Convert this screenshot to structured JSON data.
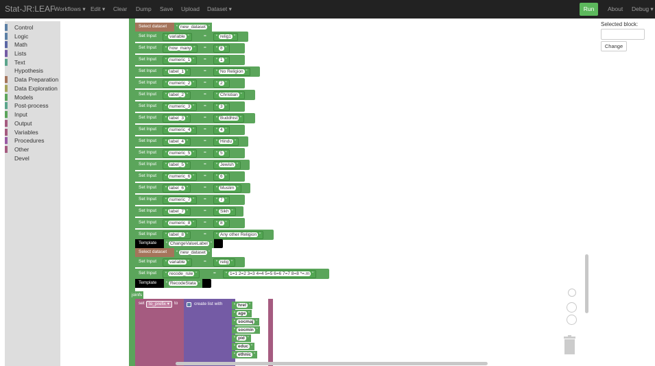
{
  "navbar": {
    "brand": "Stat-JR:LEAF",
    "items": [
      "Workflows ▾",
      "Edit ▾",
      "Clear",
      "Dump",
      "Save",
      "Upload",
      "Dataset ▾"
    ],
    "run_label": "Run",
    "about_label": "About",
    "debug_label": "Debug ▾"
  },
  "toolbox": {
    "categories": [
      {
        "label": "Control",
        "color": "#5b80a5"
      },
      {
        "label": "Logic",
        "color": "#5b80a5"
      },
      {
        "label": "Math",
        "color": "#5b67a5"
      },
      {
        "label": "Lists",
        "color": "#745ba5"
      },
      {
        "label": "Text",
        "color": "#5ba58c"
      },
      {
        "label": "Hypothesis",
        "color": ""
      },
      {
        "label": "Data Preparation",
        "color": "#a5745b"
      },
      {
        "label": "Data Exploration",
        "color": "#a5a55b"
      },
      {
        "label": "Models",
        "color": "#5ba55b"
      },
      {
        "label": "Post-process",
        "color": "#5ba58c"
      },
      {
        "label": "Input",
        "color": "#5ba55b"
      },
      {
        "label": "Output",
        "color": "#a55b80"
      },
      {
        "label": "Variables",
        "color": "#a55b80"
      },
      {
        "label": "Procedures",
        "color": "#995ba5"
      },
      {
        "label": "Other",
        "color": "#a55b80"
      },
      {
        "label": "Devel",
        "color": ""
      }
    ]
  },
  "workspace": {
    "first_select": {
      "kw": "Select dataset",
      "val": "new_dataset"
    },
    "set_inputs": [
      {
        "kw": "Set Input",
        "key": "variable",
        "val": "relig1"
      },
      {
        "kw": "Set Input",
        "key": "how_many",
        "val": "8"
      },
      {
        "kw": "Set Input",
        "key": "numeric_1",
        "val": "1"
      },
      {
        "kw": "Set Input",
        "key": "label_1",
        "val": "No Religion"
      },
      {
        "kw": "Set Input",
        "key": "numeric_2",
        "val": "2"
      },
      {
        "kw": "Set Input",
        "key": "label_2",
        "val": "Christian"
      },
      {
        "kw": "Set Input",
        "key": "numeric_3",
        "val": "3"
      },
      {
        "kw": "Set Input",
        "key": "label_3",
        "val": "Buddhist"
      },
      {
        "kw": "Set Input",
        "key": "numeric_4",
        "val": "4"
      },
      {
        "kw": "Set Input",
        "key": "label_4",
        "val": "Hindu"
      },
      {
        "kw": "Set Input",
        "key": "numeric_5",
        "val": "5"
      },
      {
        "kw": "Set Input",
        "key": "label_5",
        "val": "Jewish"
      },
      {
        "kw": "Set Input",
        "key": "numeric_6",
        "val": "6"
      },
      {
        "kw": "Set Input",
        "key": "label_6",
        "val": "Muslim"
      },
      {
        "kw": "Set Input",
        "key": "numeric_7",
        "val": "7"
      },
      {
        "kw": "Set Input",
        "key": "label_7",
        "val": "Sikh"
      },
      {
        "kw": "Set Input",
        "key": "numeric_8",
        "val": "8"
      },
      {
        "kw": "Set Input",
        "key": "label_8",
        "val": "Any other Religion"
      }
    ],
    "template1": {
      "kw": "Template",
      "val": "ChangeValueLabel"
    },
    "select2": {
      "kw": "Select dataset",
      "val": "new_dataset"
    },
    "set_inputs2": [
      {
        "kw": "Set Input",
        "key": "variable",
        "val": "relig"
      },
      {
        "kw": "Set Input",
        "key": "recode_rule",
        "val": "1=1 2=2 3=3 4=4 5=5 6=6 7=7 8=8 *=.m"
      }
    ],
    "template2": {
      "kw": "Template",
      "val": "RecodeStata"
    },
    "joinfs_label": "joinfs",
    "set_block": {
      "kw": "set",
      "var": "to_prefix",
      "to_kw": "to"
    },
    "list_block": {
      "kw": "create list with",
      "items": [
        "hrel",
        "age",
        "socmaj",
        "socmin",
        "pid",
        "educ",
        "ethnic"
      ]
    }
  },
  "right_panel": {
    "selected_label": "Selected block:",
    "selected_value": "",
    "change_label": "Change"
  }
}
